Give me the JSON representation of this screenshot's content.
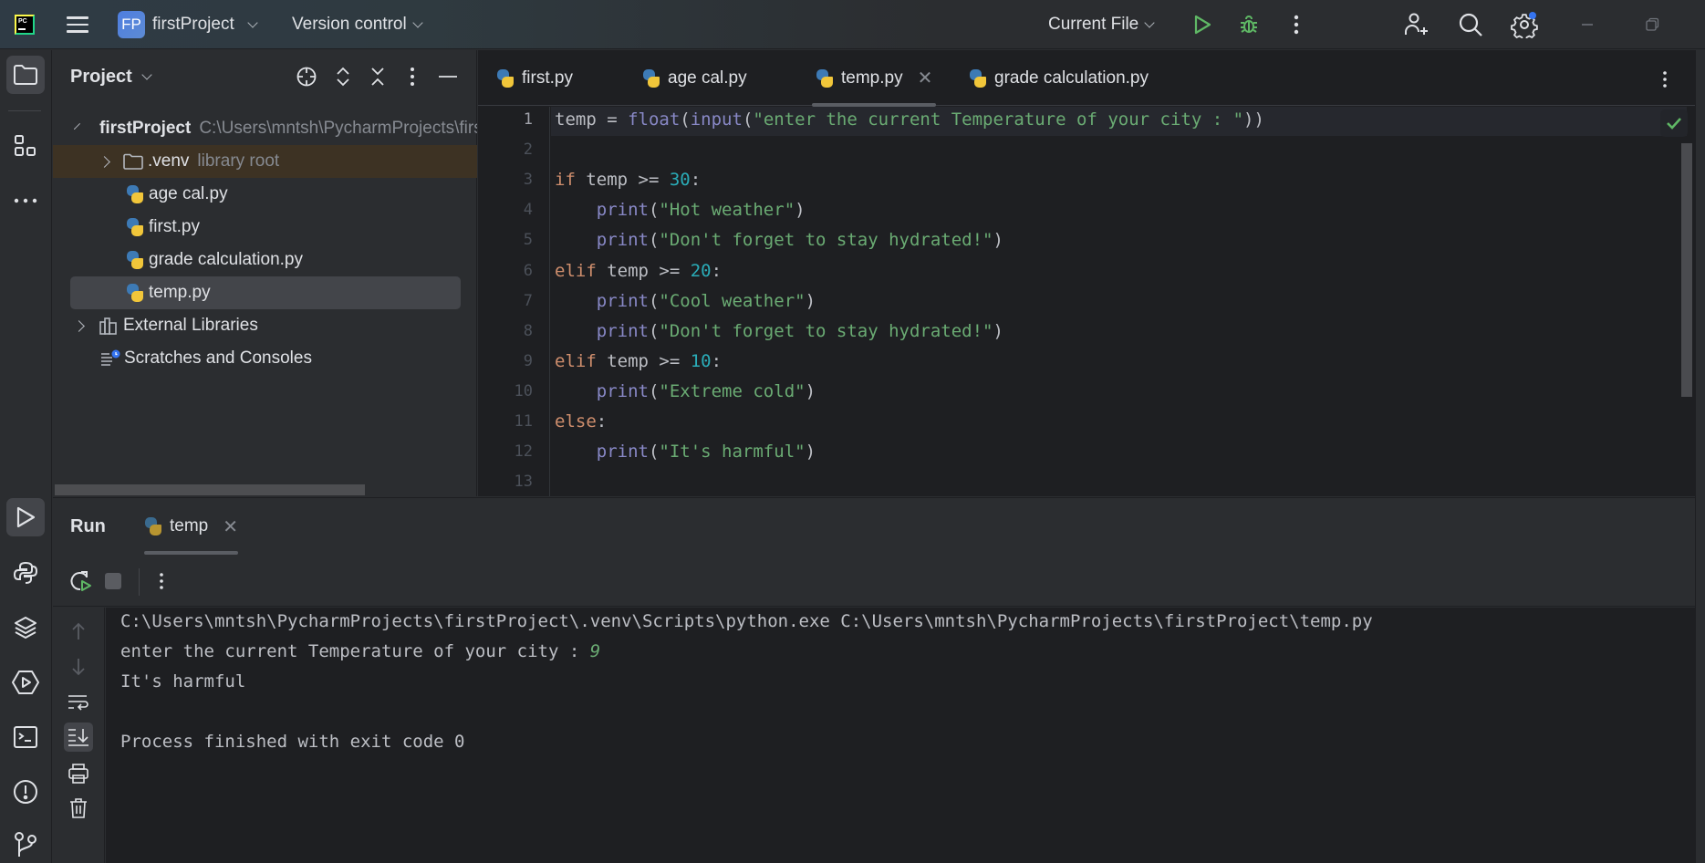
{
  "titlebar": {
    "app_logo": "pycharm-logo",
    "app_logo_text": "PC",
    "project_badge": "FP",
    "project_name": "firstProject",
    "vcs_label": "Version control",
    "run_config": "Current File"
  },
  "left_strip": {
    "items": [
      {
        "name": "project",
        "icon": "folder-icon",
        "active": true
      },
      {
        "name": "structure",
        "icon": "structure-icon",
        "active": false
      },
      {
        "name": "more",
        "icon": "more-horizontal-icon",
        "active": false
      }
    ],
    "bottom_items": [
      {
        "name": "run",
        "icon": "run-icon",
        "active": true
      },
      {
        "name": "python-console",
        "icon": "python-icon",
        "active": false
      },
      {
        "name": "python-packages",
        "icon": "layers-icon",
        "active": false
      },
      {
        "name": "services",
        "icon": "services-icon",
        "active": false
      },
      {
        "name": "terminal",
        "icon": "terminal-icon",
        "active": false
      },
      {
        "name": "problems",
        "icon": "problems-icon",
        "active": false
      },
      {
        "name": "git",
        "icon": "git-branch-icon",
        "active": false
      }
    ]
  },
  "project_panel": {
    "title": "Project",
    "tree": [
      {
        "label": "firstProject",
        "hint": "C:\\Users\\mntsh\\PycharmProjects\\firstProject",
        "type": "folder",
        "expanded": true,
        "level": 0
      },
      {
        "label": ".venv",
        "hint": "library root",
        "type": "folder",
        "expanded": false,
        "level": 1
      },
      {
        "label": "age cal.py",
        "type": "python",
        "level": 1
      },
      {
        "label": "first.py",
        "type": "python",
        "level": 1
      },
      {
        "label": "grade calculation.py",
        "type": "python",
        "level": 1
      },
      {
        "label": "temp.py",
        "type": "python",
        "level": 1,
        "selected": true
      },
      {
        "label": "External Libraries",
        "type": "library",
        "expanded": false,
        "level": 0
      },
      {
        "label": "Scratches and Consoles",
        "type": "scratches",
        "level": 0
      }
    ]
  },
  "editor": {
    "tabs": [
      {
        "label": "first.py",
        "active": false
      },
      {
        "label": "age cal.py",
        "active": false
      },
      {
        "label": "temp.py",
        "active": true
      },
      {
        "label": "grade calculation.py",
        "active": false
      }
    ],
    "current_line": 1,
    "line_numbers": [
      "1",
      "2",
      "3",
      "4",
      "5",
      "6",
      "7",
      "8",
      "9",
      "10",
      "11",
      "12",
      "13"
    ],
    "lines": [
      [
        {
          "t": "temp = ",
          "c": ""
        },
        {
          "t": "float",
          "c": "fn"
        },
        {
          "t": "(",
          "c": ""
        },
        {
          "t": "input",
          "c": "fn"
        },
        {
          "t": "(",
          "c": ""
        },
        {
          "t": "\"enter the current Temperature of your city : \"",
          "c": "str"
        },
        {
          "t": "))",
          "c": ""
        }
      ],
      [],
      [
        {
          "t": "if",
          "c": "kw"
        },
        {
          "t": " temp >= ",
          "c": ""
        },
        {
          "t": "30",
          "c": "num"
        },
        {
          "t": ":",
          "c": ""
        }
      ],
      [
        {
          "t": "    ",
          "c": ""
        },
        {
          "t": "print",
          "c": "fn"
        },
        {
          "t": "(",
          "c": ""
        },
        {
          "t": "\"Hot weather\"",
          "c": "str"
        },
        {
          "t": ")",
          "c": ""
        }
      ],
      [
        {
          "t": "    ",
          "c": ""
        },
        {
          "t": "print",
          "c": "fn"
        },
        {
          "t": "(",
          "c": ""
        },
        {
          "t": "\"Don't forget to stay hydrated!\"",
          "c": "str"
        },
        {
          "t": ")",
          "c": ""
        }
      ],
      [
        {
          "t": "elif",
          "c": "kw"
        },
        {
          "t": " temp >= ",
          "c": ""
        },
        {
          "t": "20",
          "c": "num"
        },
        {
          "t": ":",
          "c": ""
        }
      ],
      [
        {
          "t": "    ",
          "c": ""
        },
        {
          "t": "print",
          "c": "fn"
        },
        {
          "t": "(",
          "c": ""
        },
        {
          "t": "\"Cool weather\"",
          "c": "str"
        },
        {
          "t": ")",
          "c": ""
        }
      ],
      [
        {
          "t": "    ",
          "c": ""
        },
        {
          "t": "print",
          "c": "fn"
        },
        {
          "t": "(",
          "c": ""
        },
        {
          "t": "\"Don't forget to stay hydrated!\"",
          "c": "str"
        },
        {
          "t": ")",
          "c": ""
        }
      ],
      [
        {
          "t": "elif",
          "c": "kw"
        },
        {
          "t": " temp >= ",
          "c": ""
        },
        {
          "t": "10",
          "c": "num"
        },
        {
          "t": ":",
          "c": ""
        }
      ],
      [
        {
          "t": "    ",
          "c": ""
        },
        {
          "t": "print",
          "c": "fn"
        },
        {
          "t": "(",
          "c": ""
        },
        {
          "t": "\"Extreme cold\"",
          "c": "str"
        },
        {
          "t": ")",
          "c": ""
        }
      ],
      [
        {
          "t": "else",
          "c": "kw"
        },
        {
          "t": ":",
          "c": ""
        }
      ],
      [
        {
          "t": "    ",
          "c": ""
        },
        {
          "t": "print",
          "c": "fn"
        },
        {
          "t": "(",
          "c": ""
        },
        {
          "t": "\"It's harmful\"",
          "c": "str"
        },
        {
          "t": ")",
          "c": ""
        }
      ],
      []
    ],
    "inspection_status": "no-problems"
  },
  "run_panel": {
    "title": "Run",
    "tab_label": "temp",
    "console": {
      "command": "C:\\Users\\mntsh\\PycharmProjects\\firstProject\\.venv\\Scripts\\python.exe C:\\Users\\mntsh\\PycharmProjects\\firstProject\\temp.py",
      "prompt": "enter the current Temperature of your city : ",
      "user_input": "9",
      "output": "It's harmful",
      "blank": "",
      "exit_message": "Process finished with exit code 0"
    }
  },
  "colors": {
    "accent_blue": "#3574f0",
    "run_green": "#5fb865",
    "keyword": "#cf8e6d",
    "builtin": "#8888c6",
    "string": "#6aab73",
    "number": "#2aacb8",
    "venv_highlight": "#3d3223"
  }
}
